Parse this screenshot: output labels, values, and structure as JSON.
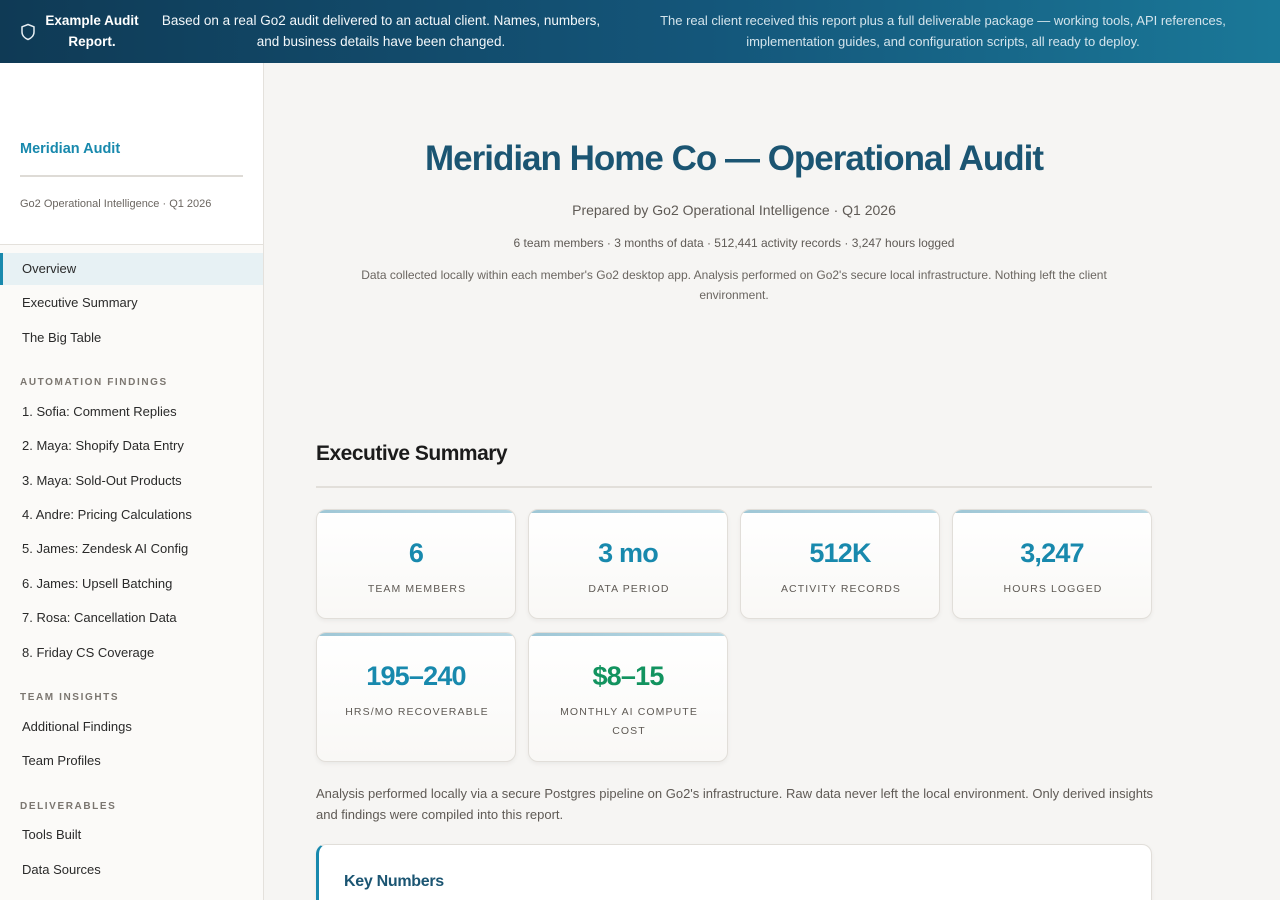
{
  "banner": {
    "title": "Example Audit Report.",
    "left_text": "Based on a real Go2 audit delivered to an actual client. Names, numbers, and business details have been changed.",
    "right_text": "The real client received this report plus a full deliverable package — working tools, API references, implementation guides, and configuration scripts, all ready to deploy.",
    "icon": "shield-icon"
  },
  "sidebar": {
    "brand": "Meridian Audit",
    "subtitle": "Go2 Operational Intelligence · Q1 2026",
    "top_items": [
      "Overview",
      "Executive Summary",
      "The Big Table"
    ],
    "sections": [
      {
        "title": "AUTOMATION FINDINGS",
        "items": [
          "1. Sofia: Comment Replies",
          "2. Maya: Shopify Data Entry",
          "3. Maya: Sold-Out Products",
          "4. Andre: Pricing Calculations",
          "5. James: Zendesk AI Config",
          "6. James: Upsell Batching",
          "7. Rosa: Cancellation Data",
          "8. Friday CS Coverage"
        ]
      },
      {
        "title": "TEAM INSIGHTS",
        "items": [
          "Additional Findings",
          "Team Profiles"
        ]
      },
      {
        "title": "DELIVERABLES",
        "items": [
          "Tools Built",
          "Data Sources"
        ]
      }
    ]
  },
  "header": {
    "title": "Meridian Home Co — Operational Audit",
    "prepared": "Prepared by Go2 Operational Intelligence · Q1 2026",
    "stats": "6 team members · 3 months of data · 512,441 activity records · 3,247 hours logged",
    "privacy": "Data collected locally within each member's Go2 desktop app. Analysis performed on Go2's secure local infrastructure. Nothing left the client environment."
  },
  "executive_summary": {
    "title": "Executive Summary",
    "cards": [
      {
        "value": "6",
        "label": "TEAM MEMBERS"
      },
      {
        "value": "3 mo",
        "label": "DATA PERIOD"
      },
      {
        "value": "512K",
        "label": "ACTIVITY RECORDS"
      },
      {
        "value": "3,247",
        "label": "HOURS LOGGED"
      },
      {
        "value": "195–240",
        "label": "HRS/MO RECOVERABLE"
      },
      {
        "value": "$8–15",
        "label": "MONTHLY AI COMPUTE COST"
      }
    ],
    "accent_green": "#12935f",
    "accent_teal": "#1889ad",
    "analysis": "Analysis performed locally via a secure Postgres pipeline on Go2's infrastructure. Raw data never left the local environment. Only derived insights and findings were compiled into this report.",
    "key_numbers_title": "Key Numbers"
  }
}
